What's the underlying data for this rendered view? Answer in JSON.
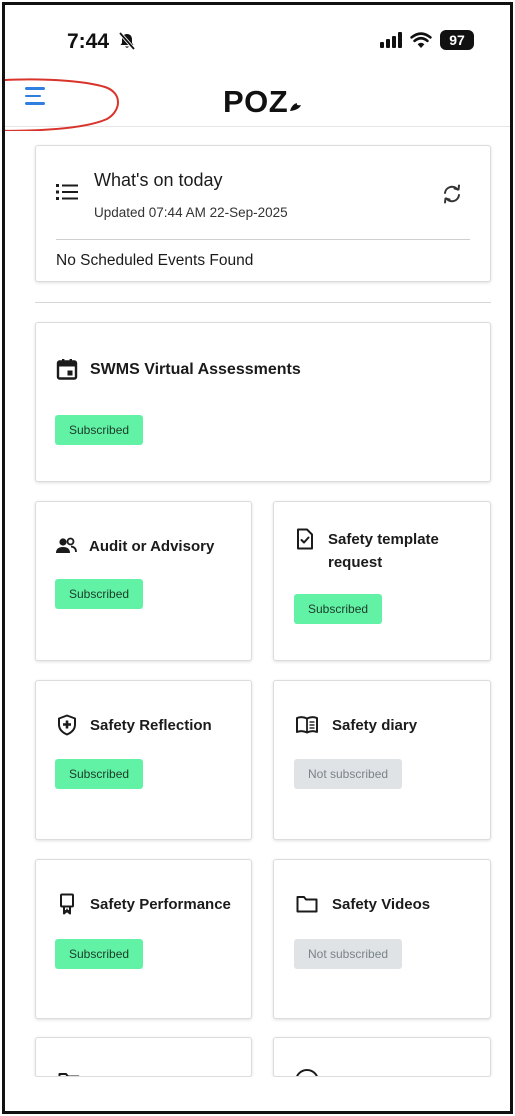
{
  "status_bar": {
    "time": "7:44",
    "battery": "97",
    "icons": [
      "bell-slash-icon",
      "signal-icon",
      "wifi-icon",
      "battery-icon"
    ]
  },
  "header": {
    "logo": "POZ",
    "menu_icon": "hamburger-menu-icon",
    "accent_color": "#2f7fe0",
    "annotation_color": "#d9342b"
  },
  "today": {
    "title": "What's on today",
    "updated": "Updated 07:44 AM 22-Sep-2025",
    "empty_message": "No Scheduled Events Found",
    "icon": "list-icon",
    "refresh_icon": "refresh-icon"
  },
  "services": [
    {
      "label": "SWMS Virtual Assessments",
      "status": "Subscribed",
      "subscribed": true,
      "icon": "calendar-icon"
    },
    {
      "label": "Audit or Advisory",
      "status": "Subscribed",
      "subscribed": true,
      "icon": "people-icon"
    },
    {
      "label": "Safety template request",
      "status": "Subscribed",
      "subscribed": true,
      "icon": "document-check-icon"
    },
    {
      "label": "Safety Reflection",
      "status": "Subscribed",
      "subscribed": true,
      "icon": "shield-plus-icon"
    },
    {
      "label": "Safety diary",
      "status": "Not subscribed",
      "subscribed": false,
      "icon": "book-icon"
    },
    {
      "label": "Safety Performance",
      "status": "Subscribed",
      "subscribed": true,
      "icon": "award-icon"
    },
    {
      "label": "Safety Videos",
      "status": "Not subscribed",
      "subscribed": false,
      "icon": "folder-icon"
    }
  ],
  "colors": {
    "subscribed_badge": "#62f2a6",
    "not_subscribed_badge": "#dfe3e5"
  }
}
